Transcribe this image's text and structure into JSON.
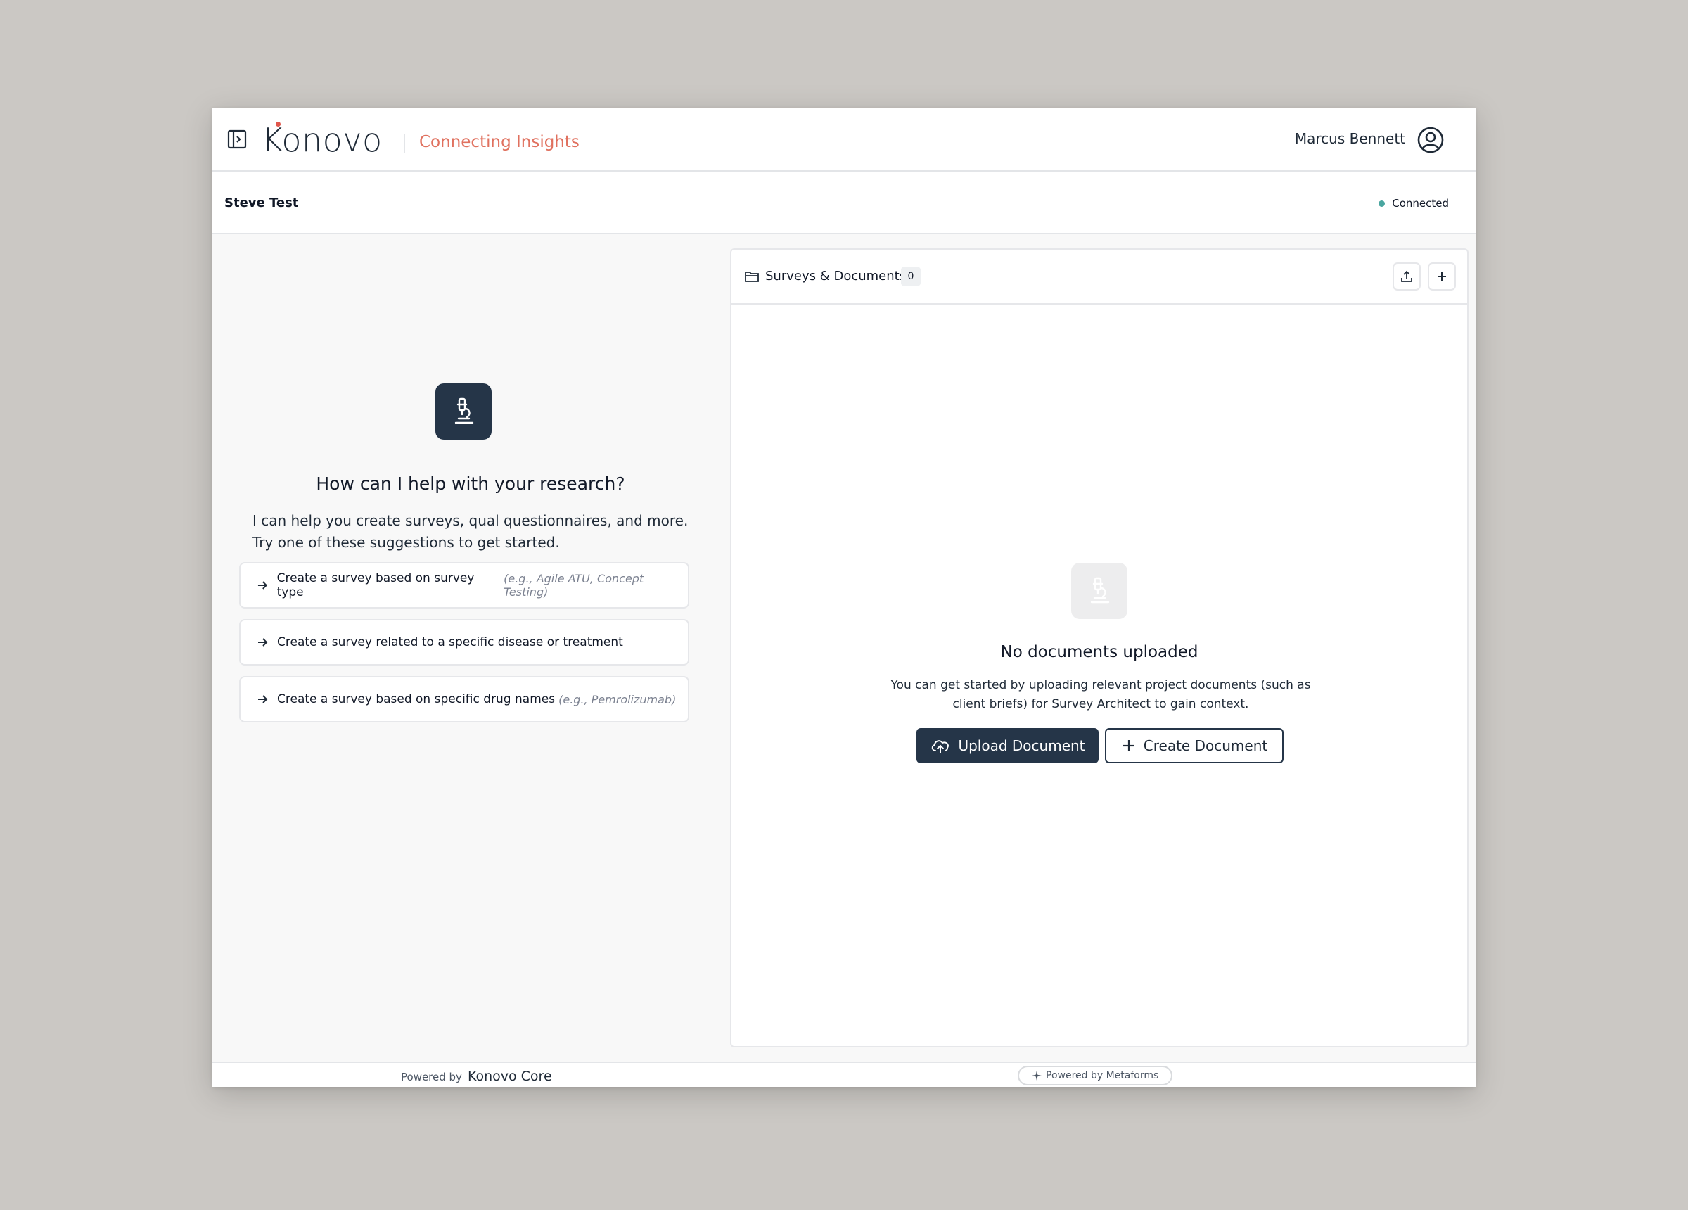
{
  "header": {
    "brand": "Konovo",
    "tagline": "Connecting Insights",
    "user_name": "Marcus Bennett"
  },
  "subheader": {
    "project_name": "Steve Test",
    "status": "Connected",
    "status_color": "#4aa6a0"
  },
  "assistant": {
    "title": "How can I help with your research?",
    "description": "I can help you create surveys, qual questionnaires, and more. Try one of these suggestions to get started.",
    "suggestions": [
      {
        "label": "Create a survey based on survey type",
        "hint": "(e.g., Agile ATU, Concept Testing)"
      },
      {
        "label": "Create a survey related to a specific disease or treatment",
        "hint": ""
      },
      {
        "label": "Create a survey based on specific drug names",
        "hint": "(e.g., Pemrolizumab)"
      }
    ],
    "input_placeholder": "How can I help with your research?"
  },
  "documents": {
    "title": "Surveys & Documents",
    "count": "0",
    "empty_title": "No documents uploaded",
    "empty_description": "You can get started by uploading relevant project documents (such as client briefs) for Survey Architect to gain context.",
    "upload_label": "Upload Document",
    "create_label": "Create Document"
  },
  "footer": {
    "powered_by": "Powered by",
    "powered_brand": "Konovo Core",
    "metaforms": "Powered by Metaforms"
  },
  "colors": {
    "primary": "#253548",
    "accent": "#e0715f",
    "logo_dot": "#e1574c"
  },
  "icons": [
    "sidebar-toggle-icon",
    "user-circle-icon",
    "microscope-icon",
    "arrow-right-icon",
    "send-icon",
    "folder-icon",
    "upload-icon",
    "plus-icon",
    "cloud-upload-icon",
    "sparkle-icon"
  ]
}
